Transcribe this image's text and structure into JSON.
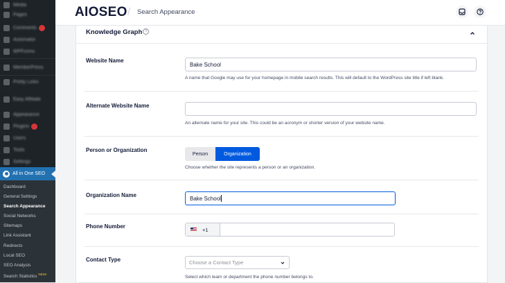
{
  "wp_sidebar": {
    "menu": [
      {
        "label": "Media",
        "badge": false
      },
      {
        "label": "Pages",
        "badge": false
      },
      {
        "label": "Comments",
        "badge": true
      },
      {
        "label": "Automator",
        "badge": false
      },
      {
        "label": "WPForms",
        "badge": false
      },
      {
        "label": "MemberPress",
        "badge": false
      },
      {
        "label": "Pretty Links",
        "badge": false
      },
      {
        "label": "Easy Affiliate",
        "badge": false
      },
      {
        "label": "Appearance",
        "badge": false
      },
      {
        "label": "Plugins",
        "badge": true
      },
      {
        "label": "Users",
        "badge": false
      },
      {
        "label": "Tools",
        "badge": false
      },
      {
        "label": "Settings",
        "badge": false
      }
    ],
    "aioseo_label": "All in One SEO",
    "submenu": [
      {
        "label": "Dashboard",
        "active": false
      },
      {
        "label": "General Settings",
        "active": false
      },
      {
        "label": "Search Appearance",
        "active": true
      },
      {
        "label": "Social Networks",
        "active": false
      },
      {
        "label": "Sitemaps",
        "active": false
      },
      {
        "label": "Link Assistant",
        "active": false
      },
      {
        "label": "Redirects",
        "active": false
      },
      {
        "label": "Local SEO",
        "active": false
      },
      {
        "label": "SEO Analysis",
        "active": false
      },
      {
        "label": "Search Statistics",
        "active": false
      }
    ],
    "new_badge": "NEW!"
  },
  "header": {
    "brand_text": "AIOSEO",
    "separator": "/",
    "page_title": "Search Appearance",
    "icons": [
      "inbox-icon",
      "help-circle-icon"
    ]
  },
  "card": {
    "title": "Knowledge Graph",
    "help_glyph": "?",
    "collapse_glyph": "^",
    "website_name": {
      "label": "Website Name",
      "value": "Bake School",
      "description": "A name that Google may use for your homepage in mobile search results. This will default to the WordPress site title if left blank."
    },
    "alternate_name": {
      "label": "Alternate Website Name",
      "value": "",
      "description": "An alternate name for your site. This could be an acronym or shorter version of your website name."
    },
    "person_org": {
      "label": "Person or Organization",
      "options": [
        "Person",
        "Organization"
      ],
      "selected": "Organization",
      "description": "Choose whether the site represents a person or an organization."
    },
    "organization_name": {
      "label": "Organization Name",
      "value": "Bake School"
    },
    "phone": {
      "label": "Phone Number",
      "country_code": "+1",
      "value": ""
    },
    "contact_type": {
      "label": "Contact Type",
      "placeholder": "Choose a Contact Type",
      "description": "Select which team or department the phone number belongs to."
    }
  },
  "colors": {
    "accent": "#005ae0",
    "wp_sidebar": "#1d2327",
    "wp_active": "#2271b1"
  }
}
